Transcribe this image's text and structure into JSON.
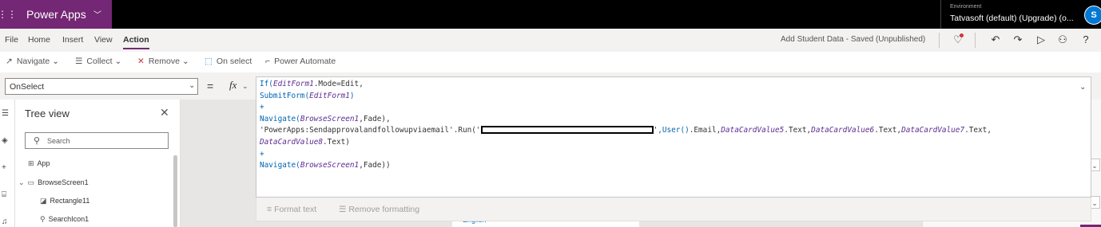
{
  "app": {
    "name": "Power Apps",
    "environment_label": "Environment",
    "environment_name": "Tatvasoft (default) (Upgrade) (o...",
    "user_initials": "S"
  },
  "menu": {
    "items": [
      "File",
      "Home",
      "Insert",
      "View",
      "Action"
    ],
    "active": "Action",
    "save_status": "Add Student Data - Saved (Unpublished)"
  },
  "commands": {
    "navigate": "Navigate",
    "collect": "Collect",
    "remove": "Remove",
    "on_select": "On select",
    "power_automate": "Power Automate"
  },
  "property": {
    "selected": "OnSelect",
    "equals": "=",
    "fx": "fx"
  },
  "formula": {
    "lines": [
      [
        {
          "t": "f",
          "x": "If("
        },
        {
          "t": "v",
          "x": "EditForm1"
        },
        {
          "t": "s",
          "x": ".Mode=Edit,"
        }
      ],
      [
        {
          "t": "f",
          "x": "SubmitForm("
        },
        {
          "t": "v",
          "x": "EditForm1"
        },
        {
          "t": "f",
          "x": ")"
        }
      ],
      [
        {
          "t": "f",
          "x": "+"
        }
      ],
      [
        {
          "t": "f",
          "x": "Navigate("
        },
        {
          "t": "v",
          "x": "BrowseScreen1"
        },
        {
          "t": "s",
          "x": ",Fade),"
        }
      ],
      [
        {
          "t": "s",
          "x": "'PowerApps:Sendapprovalandfollowupviaemail'.Run('"
        },
        {
          "t": "r",
          "x": ""
        },
        {
          "t": "s",
          "x": "'"
        },
        {
          "t": "f",
          "x": ",User()"
        },
        {
          "t": "s",
          "x": ".Email,"
        },
        {
          "t": "v",
          "x": "DataCardValue5"
        },
        {
          "t": "s",
          "x": ".Text,"
        },
        {
          "t": "v",
          "x": "DataCardValue6"
        },
        {
          "t": "s",
          "x": ".Text,"
        },
        {
          "t": "v",
          "x": "DataCardValue7"
        },
        {
          "t": "s",
          "x": ".Text,"
        }
      ],
      [
        {
          "t": "v",
          "x": "DataCardValue8"
        },
        {
          "t": "s",
          "x": ".Text)"
        }
      ],
      [
        {
          "t": "f",
          "x": "+"
        }
      ],
      [
        {
          "t": "f",
          "x": "Navigate("
        },
        {
          "t": "v",
          "x": "BrowseScreen1"
        },
        {
          "t": "s",
          "x": ",Fade))"
        }
      ]
    ]
  },
  "format_bar": {
    "format_text": "Format text",
    "remove_formatting": "Remove formatting"
  },
  "tree_view": {
    "title": "Tree view",
    "search_placeholder": "Search",
    "items": [
      {
        "label": "App",
        "icon": "app-icon"
      },
      {
        "label": "BrowseScreen1",
        "icon": "screen-icon"
      },
      {
        "label": "Rectangle11",
        "icon": "rectangle-icon"
      },
      {
        "label": "SearchIcon1",
        "icon": "search-icon"
      }
    ]
  },
  "canvas": {
    "partial_text": "English"
  },
  "colors": {
    "brand": "#742774",
    "topbar": "#000000",
    "keyword": "#0065b3",
    "variable": "#5c2d91"
  }
}
